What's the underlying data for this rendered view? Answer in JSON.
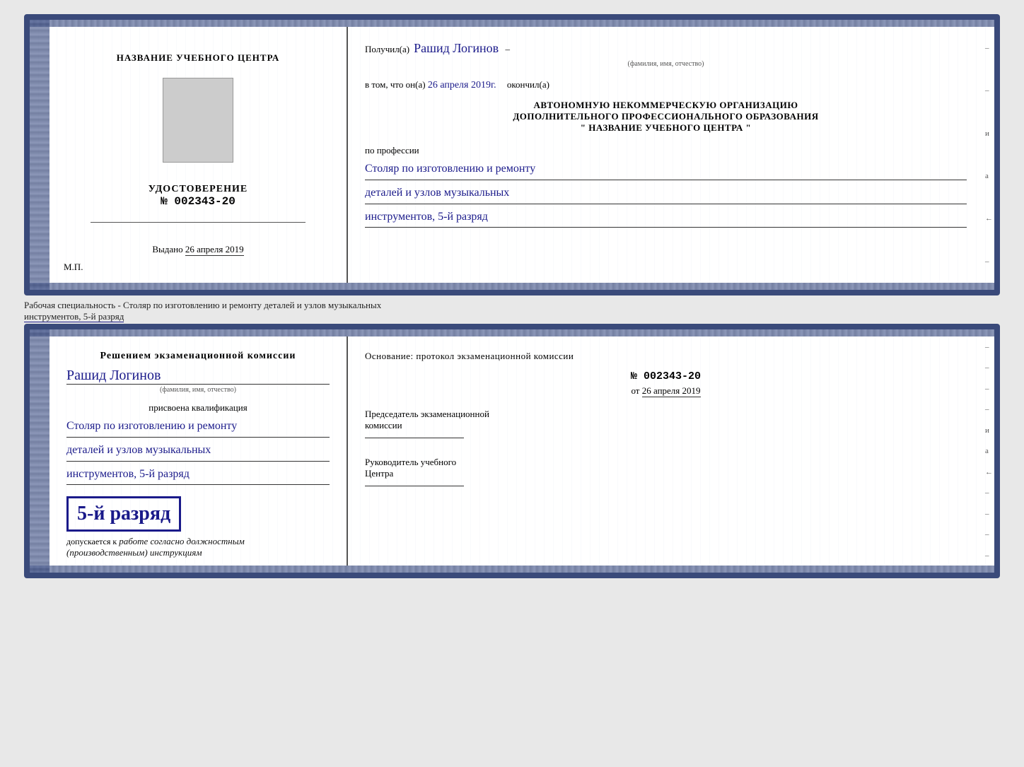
{
  "top_cert": {
    "left": {
      "school_name": "НАЗВАНИЕ УЧЕБНОГО ЦЕНТРА",
      "udostoverenie": "УДОСТОВЕРЕНИЕ",
      "number_prefix": "№",
      "number": "002343-20",
      "vydano_label": "Выдано",
      "vydano_date": "26 апреля 2019",
      "mp_label": "М.П."
    },
    "right": {
      "poluchil_label": "Получил(а)",
      "fio_value": "Рашид Логинов",
      "fio_subtext": "(фамилия, имя, отчество)",
      "vtom_label": "в том, что он(а)",
      "vtom_date": "26 апреля 2019г.",
      "okonchil_label": "окончил(а)",
      "avt_line1": "АВТОНОМНУЮ НЕКОММЕРЧЕСКУЮ ОРГАНИЗАЦИЮ",
      "avt_line2": "ДОПОЛНИТЕЛЬНОГО ПРОФЕССИОНАЛЬНОГО ОБРАЗОВАНИЯ",
      "avt_quote": "\"   НАЗВАНИЕ УЧЕБНОГО ЦЕНТРА   \"",
      "po_professii": "по профессии",
      "prof_line1": "Столяр по изготовлению и ремонту",
      "prof_line2": "деталей и узлов музыкальных",
      "prof_line3": "инструментов, 5-й разряд"
    }
  },
  "specialty_label": "Рабочая специальность - Столяр по изготовлению и ремонту деталей и узлов музыкальных",
  "specialty_label2": "инструментов, 5-й разряд",
  "bottom_cert": {
    "left": {
      "resheniem_label": "Решением экзаменационной комиссии",
      "fio_value": "Рашид Логинов",
      "fio_subtext": "(фамилия, имя, отчество)",
      "prisvoena_label": "присвоена квалификация",
      "prof_line1": "Столяр по изготовлению и ремонту",
      "prof_line2": "деталей и узлов музыкальных",
      "prof_line3": "инструментов, 5-й разряд",
      "big_razryad": "5-й разряд",
      "dopuskaetsya": "допускается к",
      "dopusk_italic": "работе согласно должностным",
      "dopusk_italic2": "(производственным) инструкциям"
    },
    "right": {
      "osnovanie_label": "Основание: протокол экзаменационной комиссии",
      "number_prefix": "№",
      "protocol_number": "002343-20",
      "ot_label": "от",
      "ot_date": "26 апреля 2019",
      "predsedatel_label": "Председатель экзаменационной",
      "komissii_label": "комиссии",
      "rukovoditel_label": "Руководитель учебного",
      "centra_label": "Центра"
    }
  },
  "right_edge": {
    "marks": [
      "–",
      "–",
      "и",
      "а",
      "←",
      "–",
      "–",
      "–",
      "–"
    ]
  }
}
